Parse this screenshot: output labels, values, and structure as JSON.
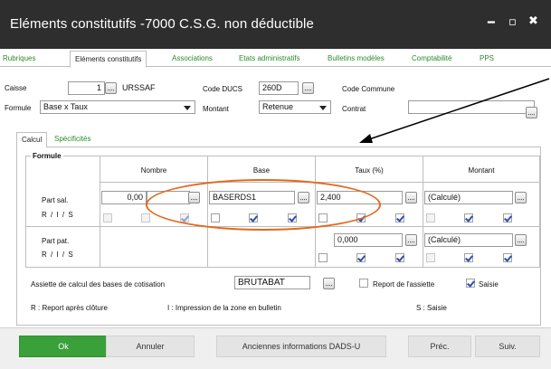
{
  "window": {
    "title": "Eléments constitutifs -7000 C.S.G. non déductible"
  },
  "main_tabs": [
    "Rubriques",
    "Eléments constitutifs",
    "Associations",
    "Etats administratifs",
    "Bulletins modèles",
    "Comptabilité",
    "PPS"
  ],
  "header": {
    "caisse_label": "Caisse",
    "caisse_value": "1",
    "caisse_name": "URSSAF",
    "code_ducs_label": "Code DUCS",
    "code_ducs_value": "260D",
    "code_commune_label": "Code Commune",
    "formule_label": "Formule",
    "formule_value": "Base x Taux",
    "montant_label": "Montant",
    "montant_value": "Retenue",
    "contrat_label": "Contrat",
    "contrat_value": ""
  },
  "sub_tabs": [
    "Calcul",
    "Spécificités"
  ],
  "grid": {
    "group_label": "Formule",
    "columns": [
      "Nombre",
      "Base",
      "Taux (%)",
      "Montant"
    ],
    "rows": [
      {
        "label": "Part sal.",
        "ris": "R / I / S",
        "nombre": "0,00",
        "base": "BASERDS1",
        "taux": "2,400",
        "montant": "(Calculé)"
      },
      {
        "label": "Part pat.",
        "ris": "R / I / S",
        "taux": "0,000",
        "montant": "(Calculé)"
      }
    ]
  },
  "assiette": {
    "label": "Assiette de calcul des bases de cotisation",
    "value": "BRUTABAT",
    "report_label": "Report de l'assiette",
    "saisie_label": "Saisie"
  },
  "legend": {
    "r": "R : Report après clôture",
    "i": "I : Impression de la zone en bulletin",
    "s": "S : Saisie"
  },
  "buttons": {
    "ok": "Ok",
    "annuler": "Annuler",
    "anciennes": "Anciennes informations DADS-U",
    "prec": "Préc.",
    "suiv": "Suiv."
  },
  "colors": {
    "titlebar": "#2e2e2e",
    "accent_green": "#3aa03a",
    "tab_text": "#2a8a2a",
    "annotation": "#e2691f"
  },
  "icons": [
    "minimize-icon",
    "maximize-icon",
    "close-icon",
    "ellipsis-icon",
    "dropdown-arrow-icon",
    "checkbox-icon",
    "annotation-arrow-icon"
  ]
}
